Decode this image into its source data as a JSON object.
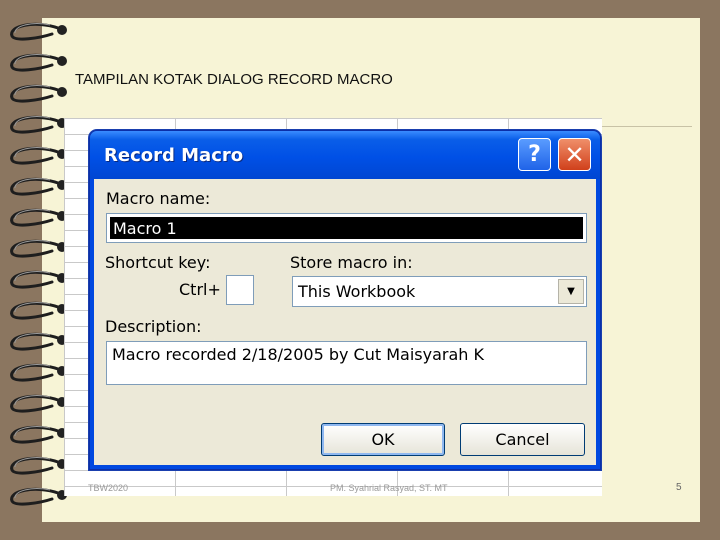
{
  "slide": {
    "title": "TAMPILAN KOTAK DIALOG RECORD MACRO",
    "footer_left": "TBW2020",
    "footer_center": "PM. Syahrial Rasyad, ST. MT",
    "page_number": "5"
  },
  "dialog": {
    "title": "Record Macro",
    "help_glyph": "?",
    "close_glyph": "✕",
    "macro_name_label": "Macro name:",
    "macro_name_value": "Macro 1",
    "shortcut_label": "Shortcut key:",
    "shortcut_prefix": "Ctrl+",
    "shortcut_value": "",
    "store_label": "Store macro in:",
    "store_value": "This Workbook",
    "description_label": "Description:",
    "description_value": "Macro recorded 2/18/2005 by Cut Maisyarah K",
    "ok_label": "OK",
    "cancel_label": "Cancel"
  },
  "icons": {
    "help": "help-icon",
    "close": "close-icon",
    "dropdown": "chevron-down-icon"
  },
  "colors": {
    "titlebar": "#0050e6",
    "dialog_face": "#ece9d8",
    "paper": "#f7f4d6",
    "background": "#8b7660"
  }
}
